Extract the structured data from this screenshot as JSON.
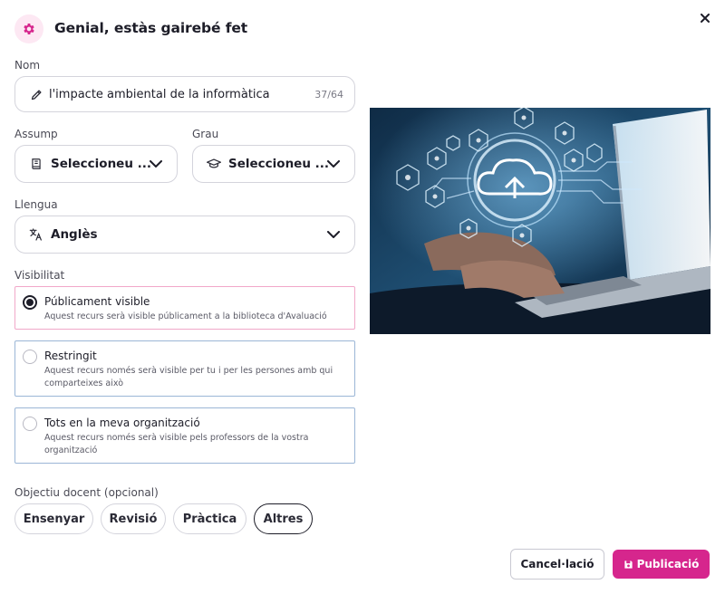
{
  "header": {
    "title": "Genial, estàs gairebé fet",
    "icon": "gear-icon",
    "accent": "#d6268d"
  },
  "form": {
    "name": {
      "label": "Nom",
      "value": "l'impacte ambiental de la informàtica",
      "counter": "37/64"
    },
    "subject": {
      "label": "Assump",
      "value": "Seleccioneu ..."
    },
    "grade": {
      "label": "Grau",
      "value": "Seleccioneu ..."
    },
    "language": {
      "label": "Llengua",
      "value": "Anglès"
    },
    "visibility": {
      "label": "Visibilitat",
      "options": [
        {
          "title": "Públicament visible",
          "description": "Aquest recurs serà visible públicament a la biblioteca d'Avaluació",
          "selected": true
        },
        {
          "title": "Restringit",
          "description": "Aquest recurs només serà visible per tu i per les persones amb qui comparteixes això",
          "selected": false
        },
        {
          "title": "Tots en la meva organització",
          "description": "Aquest recurs només serà visible pels professors de la vostra organització",
          "selected": false
        }
      ]
    },
    "objective": {
      "label": "Objectiu docent (opcional)",
      "chips": [
        {
          "label": "Ensenyar",
          "active": false
        },
        {
          "label": "Revisió",
          "active": false
        },
        {
          "label": "Pràctica",
          "active": false
        },
        {
          "label": "Altres",
          "active": true
        }
      ]
    }
  },
  "footer": {
    "cancel_label": "Cancel·lació",
    "publish_label": "Publicació"
  }
}
